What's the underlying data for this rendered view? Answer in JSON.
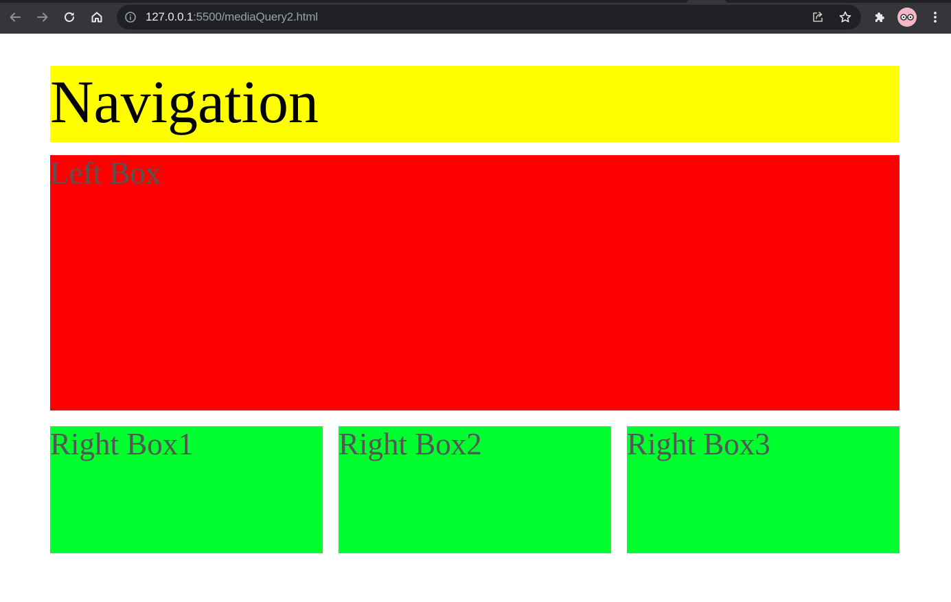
{
  "browser": {
    "url_host": "127.0.0.1",
    "url_rest": ":5500/mediaQuery2.html",
    "icons": {
      "back": "arrow-left-icon",
      "forward": "arrow-right-icon",
      "reload": "reload-icon",
      "home": "home-icon",
      "site_info": "info-icon",
      "share": "share-icon",
      "bookmark": "star-icon",
      "extensions": "puzzle-icon",
      "profile": "avatar",
      "menu": "kebab-menu-icon"
    }
  },
  "page": {
    "navigation_text": "Navigation",
    "left_box_text": "Left Box",
    "right_boxes": [
      {
        "label": "Right Box1"
      },
      {
        "label": "Right Box2"
      },
      {
        "label": "Right Box3"
      }
    ]
  },
  "colors": {
    "navigation_bg": "#ffff00",
    "left_box_bg": "#ff0000",
    "right_box_bg": "#00ff2e",
    "box_text": "#555555",
    "browser_toolbar": "#35363a",
    "omnibox": "#202124"
  }
}
